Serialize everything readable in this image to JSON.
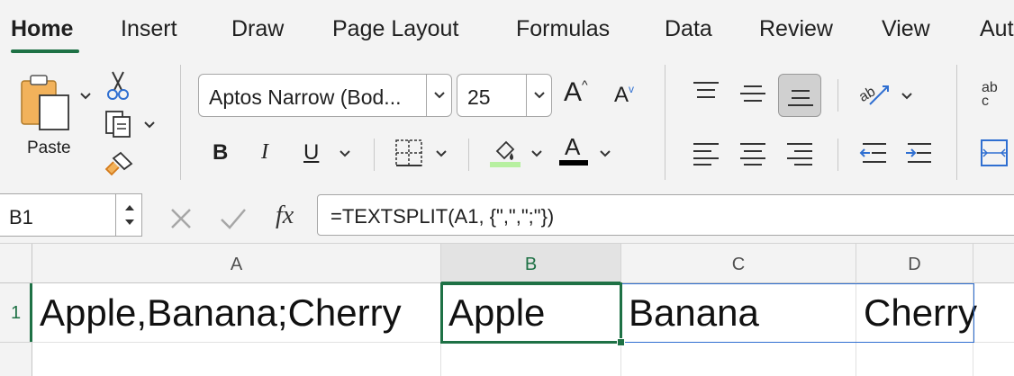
{
  "tabs": [
    {
      "label": "Home",
      "active": true
    },
    {
      "label": "Insert",
      "active": false
    },
    {
      "label": "Draw",
      "active": false
    },
    {
      "label": "Page Layout",
      "active": false
    },
    {
      "label": "Formulas",
      "active": false
    },
    {
      "label": "Data",
      "active": false
    },
    {
      "label": "Review",
      "active": false
    },
    {
      "label": "View",
      "active": false
    },
    {
      "label": "Aut",
      "active": false
    }
  ],
  "ribbon": {
    "paste_label": "Paste",
    "font_name": "Aptos Narrow (Bod...",
    "font_size": "25",
    "bold_label": "B",
    "italic_label": "I",
    "underline_label": "U",
    "grow_font_label": "A",
    "shrink_font_label": "A",
    "font_color_label": "A",
    "wrap_text_label": "ab c",
    "fill_color": "#b7f0a0",
    "font_color": "#000000"
  },
  "formula_bar": {
    "name_box": "B1",
    "fx_label": "fx",
    "formula": "=TEXTSPLIT(A1, {\",\",\";\"})"
  },
  "grid": {
    "columns": [
      {
        "label": "A",
        "selected": false
      },
      {
        "label": "B",
        "selected": true
      },
      {
        "label": "C",
        "selected": false
      },
      {
        "label": "D",
        "selected": false
      }
    ],
    "rows": [
      {
        "label": "1",
        "selected": true
      }
    ],
    "cells": {
      "A1": "Apple,Banana;Cherry",
      "B1": "Apple",
      "C1": "Banana",
      "D1": "Cherry"
    }
  },
  "colors": {
    "accent_green": "#1e7145",
    "spill_blue": "#2f6fd1"
  }
}
